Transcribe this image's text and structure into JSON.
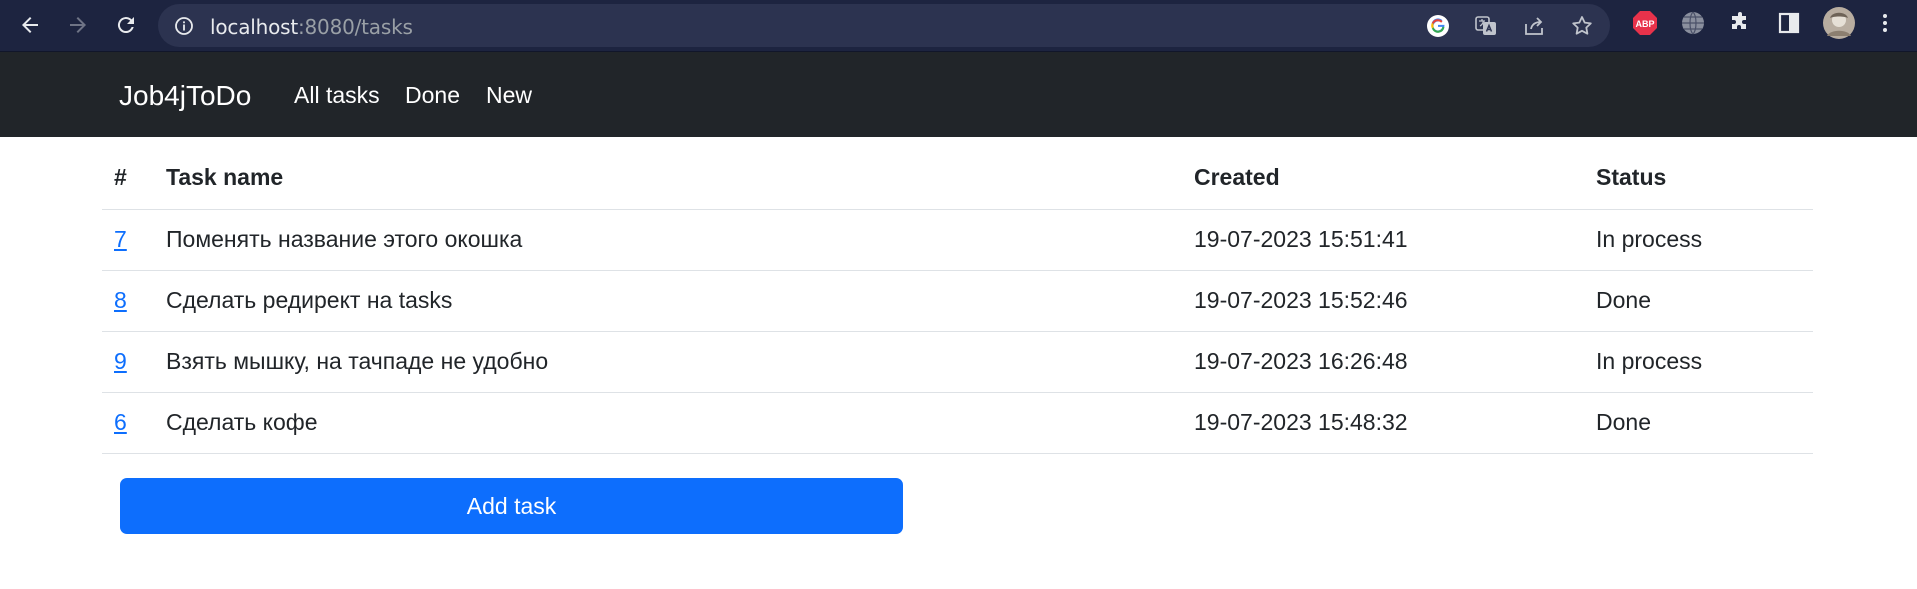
{
  "browser": {
    "url_host": "localhost",
    "url_rest": ":8080/tasks",
    "extension_abp_label": "ABP"
  },
  "navbar": {
    "brand": "Job4jToDo",
    "links": [
      "All tasks",
      "Done",
      "New"
    ]
  },
  "table": {
    "headers": [
      "#",
      "Task name",
      "Created",
      "Status"
    ],
    "rows": [
      {
        "id": "7",
        "name": "Поменять название этого окошка",
        "created": "19-07-2023 15:51:41",
        "status": "In process"
      },
      {
        "id": "8",
        "name": "Сделать редирект на tasks",
        "created": "19-07-2023 15:52:46",
        "status": "Done"
      },
      {
        "id": "9",
        "name": "Взять мышку, на тачпаде не удобно",
        "created": "19-07-2023 16:26:48",
        "status": "In process"
      },
      {
        "id": "6",
        "name": "Сделать кофе",
        "created": "19-07-2023 15:48:32",
        "status": "Done"
      }
    ]
  },
  "add_button_label": "Add task",
  "colors": {
    "chrome_bg": "#1d2440",
    "navbar_bg": "#212529",
    "primary": "#0d6efd",
    "link": "#0d6efd"
  }
}
